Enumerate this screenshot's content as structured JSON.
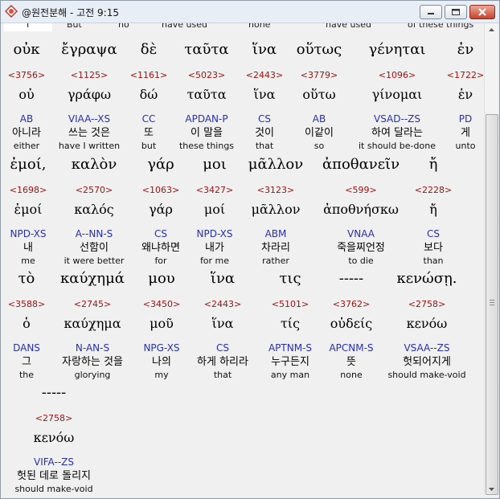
{
  "window": {
    "title": "@원전분해 - 고전 9:15"
  },
  "topline": [
    "I",
    "But",
    "no",
    "have used",
    "none",
    "have used",
    "of these things"
  ],
  "rows": [
    {
      "words": [
        {
          "greek": "οὐκ",
          "num": "<3756>",
          "lemma": "οὐ",
          "morph": "AB",
          "korean": "아니라",
          "english": "either"
        },
        {
          "greek": "ἔγραψα",
          "num": "<1125>",
          "lemma": "γράφω",
          "morph": "VIAA--XS",
          "korean": "쓰는 것은",
          "english": "have I written"
        },
        {
          "greek": "δὲ",
          "num": "<1161>",
          "lemma": "δώ",
          "morph": "CC",
          "korean": "또",
          "english": "but"
        },
        {
          "greek": "ταῦτα",
          "num": "<5023>",
          "lemma": "ταῦτα",
          "morph": "APDAN-P",
          "korean": "이 말을",
          "english": "these things"
        },
        {
          "greek": "ἵνα",
          "num": "<2443>",
          "lemma": "ἵνα",
          "morph": "CS",
          "korean": "것이",
          "english": "that"
        },
        {
          "greek": "οὕτως",
          "num": "<3779>",
          "lemma": "οὕτω",
          "morph": "AB",
          "korean": "이같이",
          "english": "so"
        },
        {
          "greek": "γένηται",
          "num": "<1096>",
          "lemma": "γίνομαι",
          "morph": "VSAD--ZS",
          "korean": "하여 달라는",
          "english": "it should be-done"
        },
        {
          "greek": "ἐν",
          "num": "<1722>",
          "lemma": "ἐν",
          "morph": "PD",
          "korean": "게",
          "english": "unto"
        }
      ]
    },
    {
      "words": [
        {
          "greek": "ἐμοί,",
          "num": "<1698>",
          "lemma": "ἐμοί",
          "morph": "NPD-XS",
          "korean": "내",
          "english": "me"
        },
        {
          "greek": "καλὸν",
          "num": "<2570>",
          "lemma": "καλός",
          "morph": "A--NN-S",
          "korean": "선함이",
          "english": "it were better"
        },
        {
          "greek": "γάρ",
          "num": "<1063>",
          "lemma": "γάρ",
          "morph": "CS",
          "korean": "왜냐하면",
          "english": "for"
        },
        {
          "greek": "μοι",
          "num": "<3427>",
          "lemma": "μοί",
          "morph": "NPD-XS",
          "korean": "내가",
          "english": "for me"
        },
        {
          "greek": "μᾶλλον",
          "num": "<3123>",
          "lemma": "μᾶλλον",
          "morph": "ABM",
          "korean": "차라리",
          "english": "rather"
        },
        {
          "greek": "ἀποθανεῖν",
          "num": "<599>",
          "lemma": "ἀποθνήσκω",
          "morph": "VNAA",
          "korean": "죽을찌언정",
          "english": "to die"
        },
        {
          "greek": "ἤ",
          "num": "<2228>",
          "lemma": "ἤ",
          "morph": "CS",
          "korean": "보다",
          "english": "than"
        }
      ]
    },
    {
      "words": [
        {
          "greek": "τὸ",
          "num": "<3588>",
          "lemma": "ὁ",
          "morph": "DANS",
          "korean": "그",
          "english": "the"
        },
        {
          "greek": "καύχημά",
          "num": "<2745>",
          "lemma": "καύχημα",
          "morph": "N-AN-S",
          "korean": "자랑하는 것을",
          "english": "glorying"
        },
        {
          "greek": "μου",
          "num": "<3450>",
          "lemma": "μοῦ",
          "morph": "NPG-XS",
          "korean": "나의",
          "english": "my"
        },
        {
          "greek": "ἵνα",
          "num": "<2443>",
          "lemma": "ἵνα",
          "morph": "CS",
          "korean": "하게 하리라",
          "english": "that"
        },
        {
          "greek": "τις",
          "num": "<5101>",
          "lemma": "τίς",
          "morph": "APTNM-S",
          "korean": "누구든지",
          "english": "any man"
        },
        {
          "greek": "-----",
          "num": "<3762>",
          "lemma": "οὐδείς",
          "morph": "APCNM-S",
          "korean": "뜻",
          "english": "none"
        },
        {
          "greek": "κενώσῃ.",
          "num": "<2758>",
          "lemma": "κενόω",
          "morph": "VSAA--ZS",
          "korean": "헛되어지게",
          "english": "should make-void"
        }
      ]
    },
    {
      "words": [
        {
          "greek": "-----",
          "num": "<2758>",
          "lemma": "κενόω",
          "morph": "VIFA--ZS",
          "korean": "헛된 데로 돌리지",
          "english": "should make-void"
        }
      ]
    }
  ]
}
